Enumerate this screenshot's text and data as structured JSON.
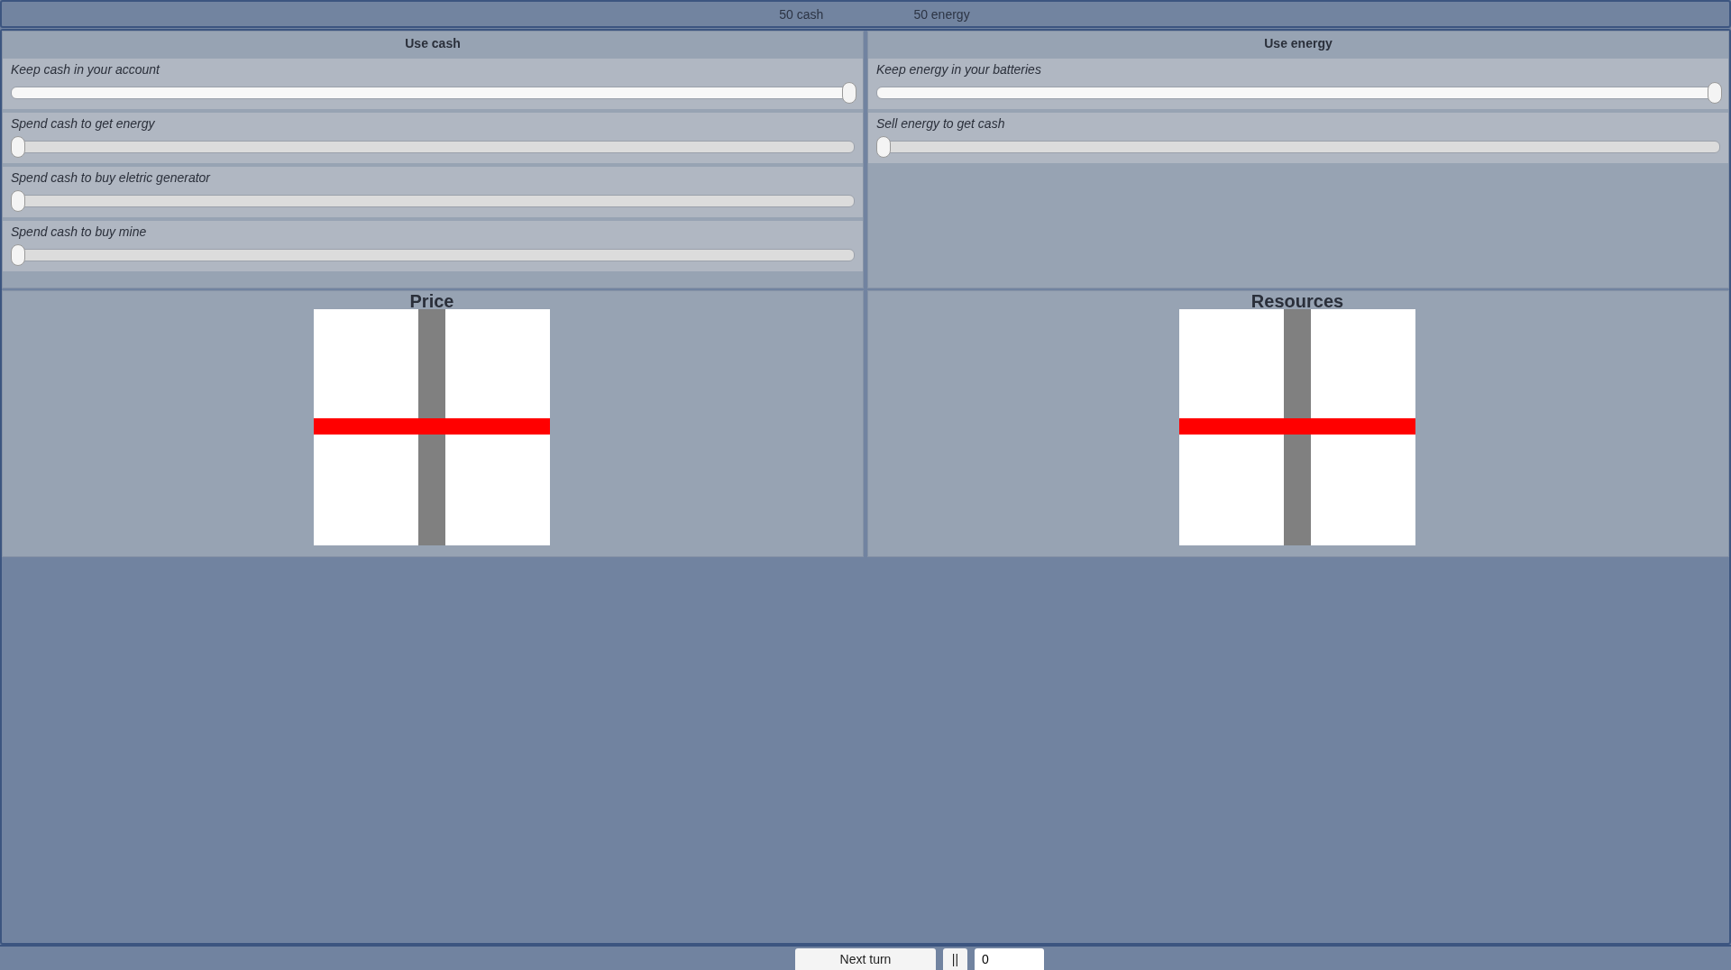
{
  "status_bar": {
    "cash": "50 cash",
    "energy": "50 energy"
  },
  "panels": [
    {
      "title": "Use cash",
      "sliders": [
        {
          "label": "Keep cash in your account",
          "level": 1
        },
        {
          "label": "Spend cash to get energy",
          "level": 0
        },
        {
          "label": "Spend cash to buy eletric generator",
          "level": 0
        },
        {
          "label": "Spend cash to buy mine",
          "level": 0
        }
      ]
    },
    {
      "title": "Use energy",
      "sliders": [
        {
          "label": "Keep energy in your batteries",
          "level": 1
        },
        {
          "label": "Sell energy to get cash",
          "level": 0
        }
      ]
    }
  ],
  "charts": [
    {
      "title": "Price"
    },
    {
      "title": "Resources"
    }
  ],
  "footer": {
    "next_button": "Next turn",
    "pause_button": "||",
    "turn_field": "0"
  }
}
